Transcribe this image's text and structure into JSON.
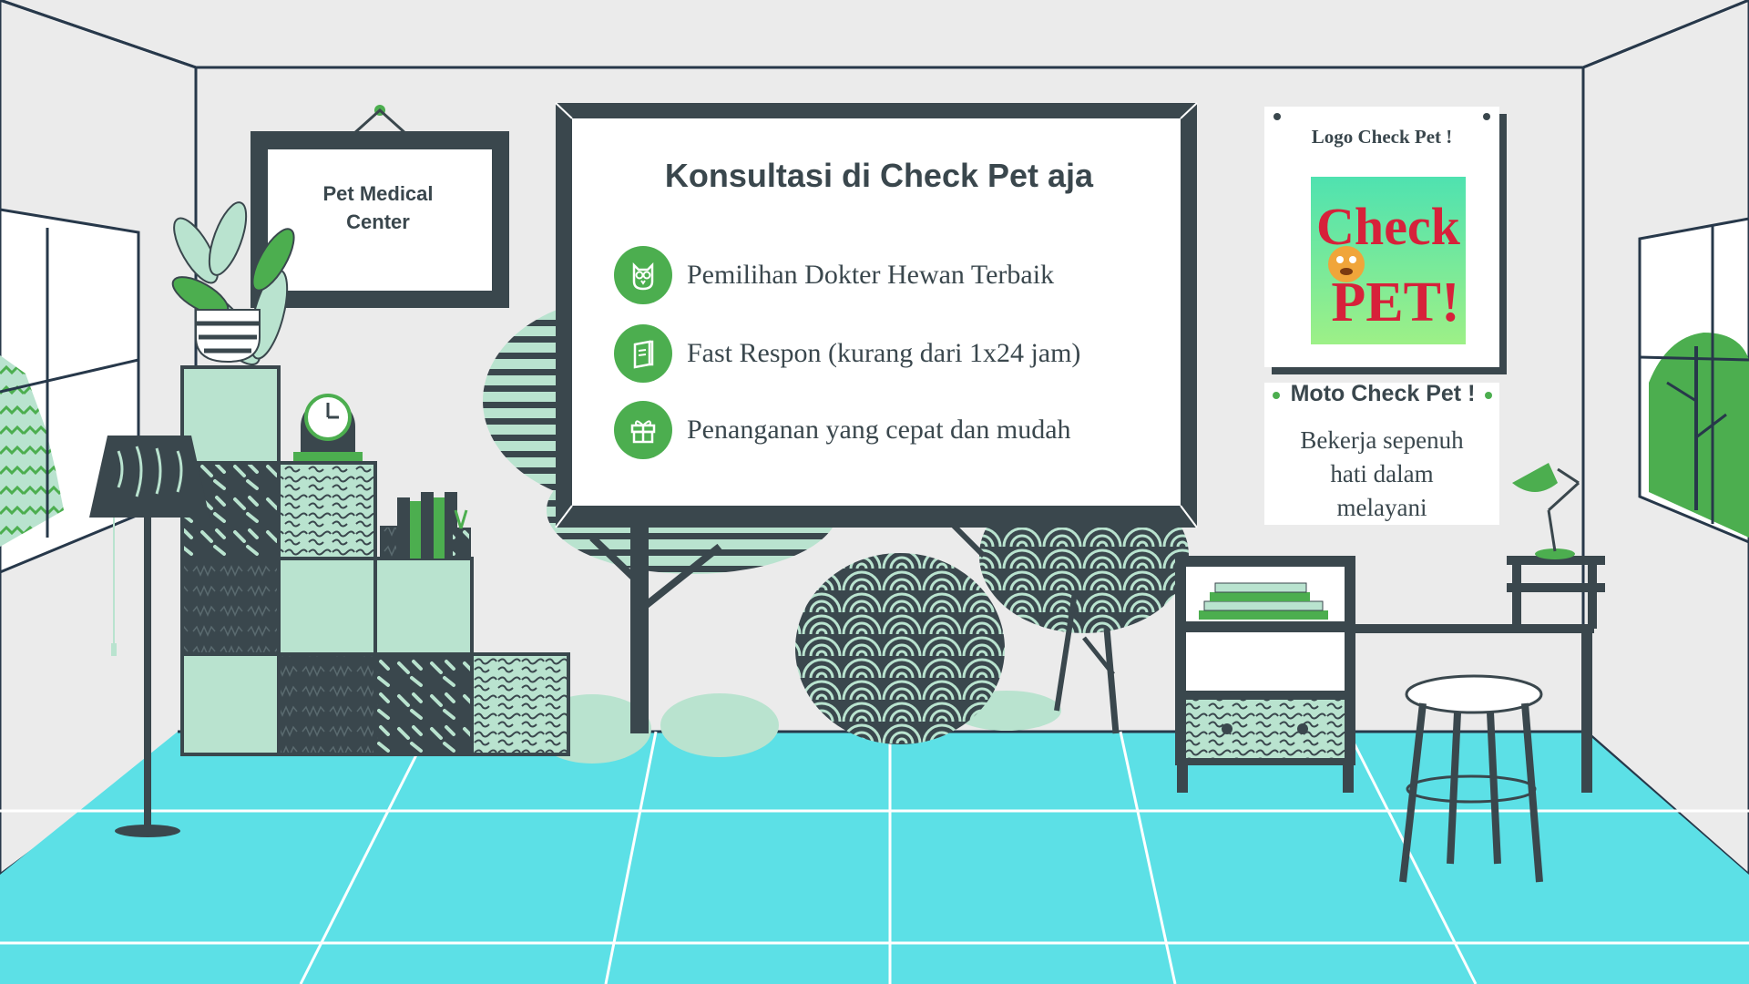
{
  "frame": {
    "line1": "Pet Medical",
    "line2": "Center"
  },
  "board": {
    "title": "Konsultasi di Check Pet aja",
    "items": [
      {
        "icon": "owl-icon",
        "label": "Pemilihan Dokter Hewan Terbaik"
      },
      {
        "icon": "notebook-icon",
        "label": "Fast Respon (kurang dari 1x24 jam)"
      },
      {
        "icon": "gift-icon",
        "label": "Penanganan yang cepat dan mudah"
      }
    ]
  },
  "logo_card": {
    "title": "Logo Check Pet !",
    "logo_line1": "Check",
    "logo_line2": "PET!"
  },
  "moto_card": {
    "title": "Moto Check Pet !",
    "line1": "Bekerja sepenuh",
    "line2": "hati dalam",
    "line3": "melayani"
  },
  "colors": {
    "dark": "#3a474d",
    "green": "#4cae4f",
    "mint": "#b9e3cf",
    "floor": "#5ce0e6",
    "wall": "#ebebeb",
    "logo_red": "#d7213a"
  }
}
